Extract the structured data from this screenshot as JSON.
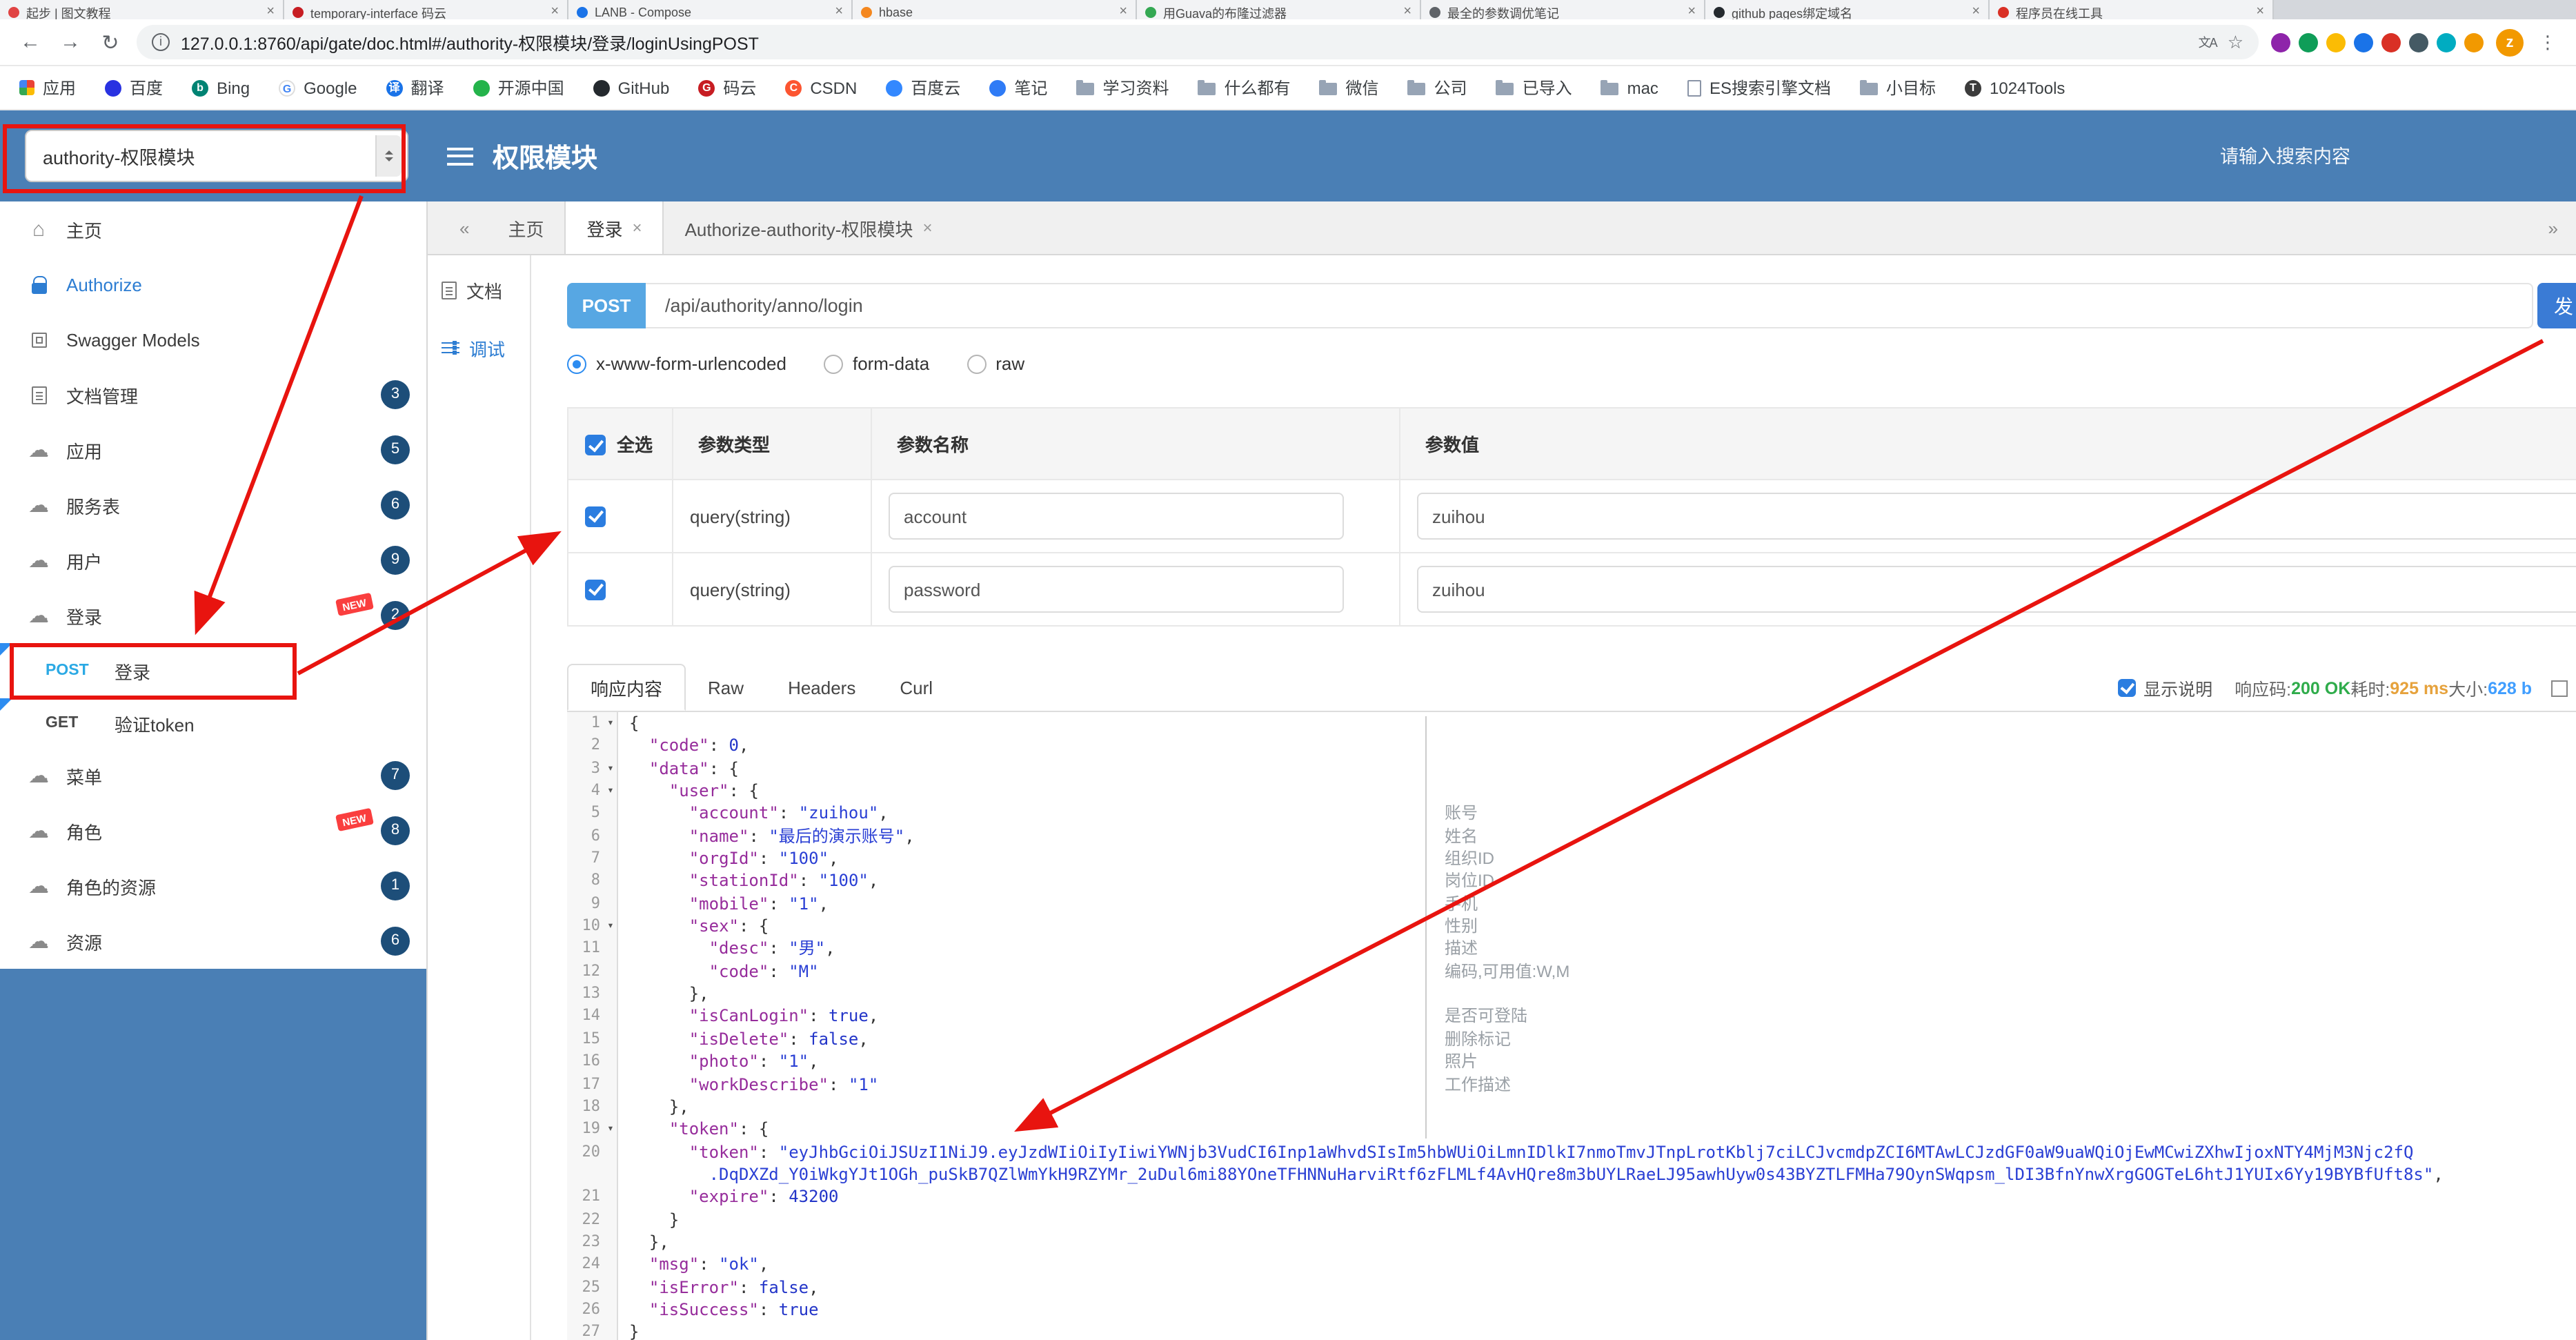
{
  "colors": {
    "header": "#4a7fb5",
    "badge": "#1d4e79",
    "post": "#57a7e3",
    "accent": "#2d7dd2",
    "red": "#e8140f",
    "key": "#962c9b",
    "str": "#2a3fd4",
    "lit": "#2335c8",
    "status_ok": "#2fac4b",
    "status_time": "#e6a23c",
    "status_size": "#409eff"
  },
  "browser": {
    "tabs": [
      {
        "title": "起步 | 图文教程",
        "color": "#e04343"
      },
      {
        "title": "temporary-interface 码云",
        "color": "#c71d23"
      },
      {
        "title": "LANB - Compose",
        "color": "#1a73e8"
      },
      {
        "title": "hbase",
        "color": "#f4871f"
      },
      {
        "title": "用Guava的布隆过滤器",
        "color": "#34a853"
      },
      {
        "title": "最全的参数调优笔记",
        "color": "#5f6368"
      },
      {
        "title": "github pages绑定域名",
        "color": "#24292e"
      },
      {
        "title": "程序员在线工具",
        "color": "#d93025"
      }
    ],
    "address": {
      "url": "127.0.0.1:8760/api/gate/doc.html#/authority-权限模块/登录/loginUsingPOST"
    },
    "extensions": [
      {
        "name": "extension-icon",
        "color": "#8e24aa"
      },
      {
        "name": "extension-icon",
        "color": "#0f9d58"
      },
      {
        "name": "extension-icon",
        "color": "#fbbc04"
      },
      {
        "name": "extension-icon",
        "color": "#1a73e8"
      },
      {
        "name": "extension-icon",
        "color": "#d93025"
      },
      {
        "name": "extension-icon",
        "color": "#455a64"
      },
      {
        "name": "extension-icon",
        "color": "#00acc1"
      },
      {
        "name": "extension-icon",
        "color": "#f29900"
      }
    ],
    "avatar": {
      "letter": "z",
      "color": "#f29900"
    },
    "bookmarks": [
      {
        "key": "apps",
        "label": "应用",
        "kind": "grid"
      },
      {
        "key": "baidu",
        "label": "百度",
        "kind": "site",
        "color": "#2932e1"
      },
      {
        "key": "bing",
        "label": "Bing",
        "kind": "site",
        "color": "#008373",
        "letter": "b"
      },
      {
        "key": "google",
        "label": "Google",
        "kind": "site",
        "color": "#ffffff",
        "letter": "G",
        "border": true
      },
      {
        "key": "translate",
        "label": "翻译",
        "kind": "site",
        "color": "#1a73e8",
        "letter": "译"
      },
      {
        "key": "oschina",
        "label": "开源中国",
        "kind": "site",
        "color": "#24b34b"
      },
      {
        "key": "github",
        "label": "GitHub",
        "kind": "site",
        "color": "#24292e"
      },
      {
        "key": "gitee",
        "label": "码云",
        "kind": "site",
        "color": "#c71d23",
        "letter": "G"
      },
      {
        "key": "csdn",
        "label": "CSDN",
        "kind": "site",
        "color": "#fc5531",
        "letter": "C"
      },
      {
        "key": "baiduyun",
        "label": "百度云",
        "kind": "site",
        "color": "#3388ff"
      },
      {
        "key": "note",
        "label": "笔记",
        "kind": "site",
        "color": "#2f7bf6"
      },
      {
        "key": "study",
        "label": "学习资料",
        "kind": "folder"
      },
      {
        "key": "everything",
        "label": "什么都有",
        "kind": "folder"
      },
      {
        "key": "wechat",
        "label": "微信",
        "kind": "folder"
      },
      {
        "key": "company",
        "label": "公司",
        "kind": "folder"
      },
      {
        "key": "imported",
        "label": "已导入",
        "kind": "folder"
      },
      {
        "key": "mac",
        "label": "mac",
        "kind": "folder"
      },
      {
        "key": "es",
        "label": "ES搜索引擎文档",
        "kind": "doc"
      },
      {
        "key": "goal",
        "label": "小目标",
        "kind": "folder"
      },
      {
        "key": "tools",
        "label": "1024Tools",
        "kind": "site",
        "color": "#3c3c3c",
        "letter": "T"
      }
    ]
  },
  "header": {
    "module_select": "authority-权限模块",
    "title": "权限模块",
    "search_placeholder": "请输入搜索内容"
  },
  "sidebar": {
    "items": [
      {
        "key": "home",
        "label": "主页",
        "icon": "home"
      },
      {
        "key": "authorize",
        "label": "Authorize",
        "icon": "lock",
        "accent": true
      },
      {
        "key": "swagger-models",
        "label": "Swagger Models",
        "icon": "models"
      },
      {
        "key": "doc-manage",
        "label": "文档管理",
        "icon": "docs",
        "badge": "3"
      },
      {
        "key": "app",
        "label": "应用",
        "icon": "cloud",
        "badge": "5"
      },
      {
        "key": "service",
        "label": "服务表",
        "icon": "cloud",
        "badge": "6"
      },
      {
        "key": "user",
        "label": "用户",
        "icon": "cloud",
        "badge": "9"
      },
      {
        "key": "login",
        "label": "登录",
        "icon": "cloud",
        "badge": "2",
        "new": true
      },
      {
        "key": "post-login",
        "label": "登录",
        "method": "POST",
        "sub": true,
        "marked": true
      },
      {
        "key": "get-token",
        "label": "验证token",
        "method": "GET",
        "sub": true,
        "marked": true
      },
      {
        "key": "menu",
        "label": "菜单",
        "icon": "cloud",
        "badge": "7"
      },
      {
        "key": "role",
        "label": "角色",
        "icon": "cloud",
        "badge": "8",
        "new": true
      },
      {
        "key": "role-resource",
        "label": "角色的资源",
        "icon": "cloud",
        "badge": "1"
      },
      {
        "key": "resource",
        "label": "资源",
        "icon": "cloud",
        "badge": "6"
      }
    ]
  },
  "tabs": {
    "collapse_left": "«",
    "collapse_right": "»",
    "items": [
      {
        "label": "主页",
        "closable": false
      },
      {
        "label": "登录",
        "closable": true,
        "active": true
      },
      {
        "label": "Authorize-authority-权限模块",
        "closable": true
      }
    ]
  },
  "doc_nav": [
    {
      "key": "doc",
      "label": "文档",
      "icon": "doc"
    },
    {
      "key": "debug",
      "label": "调试",
      "icon": "debug",
      "active": true
    }
  ],
  "request": {
    "method": "POST",
    "url": "/api/authority/anno/login",
    "send_label": "发",
    "content_types": [
      {
        "label": "x-www-form-urlencoded",
        "selected": true
      },
      {
        "label": "form-data",
        "selected": false
      },
      {
        "label": "raw",
        "selected": false
      }
    ]
  },
  "params_table": {
    "headers": [
      "全选",
      "参数类型",
      "参数名称",
      "参数值"
    ],
    "select_all_checked": true,
    "rows": [
      {
        "checked": true,
        "type": "query(string)",
        "name": "account",
        "value": "zuihou"
      },
      {
        "checked": true,
        "type": "query(string)",
        "name": "password",
        "value": "zuihou"
      }
    ]
  },
  "response": {
    "tabs": [
      {
        "label": "响应内容",
        "active": true
      },
      {
        "label": "Raw",
        "active": false
      },
      {
        "label": "Headers",
        "active": false
      },
      {
        "label": "Curl",
        "active": false
      }
    ],
    "show_desc_label": "显示说明",
    "show_desc_checked": true,
    "meta": [
      {
        "label": "响应码:",
        "value": "200 OK",
        "color": "#2fac4b"
      },
      {
        "label": "耗时:",
        "value": "925 ms",
        "color": "#e6a23c"
      },
      {
        "label": "大小:",
        "value": "628 b",
        "color": "#409eff"
      }
    ]
  },
  "code": {
    "lines": [
      {
        "n": "1",
        "fold": true,
        "s": [
          [
            "{",
            "p"
          ]
        ]
      },
      {
        "n": "2",
        "s": [
          [
            "  ",
            "p"
          ],
          [
            "\"code\"",
            "k"
          ],
          [
            ": ",
            "p"
          ],
          [
            "0",
            "l"
          ],
          [
            ",",
            "p"
          ]
        ]
      },
      {
        "n": "3",
        "fold": true,
        "s": [
          [
            "  ",
            "p"
          ],
          [
            "\"data\"",
            "k"
          ],
          [
            ": ",
            "p"
          ],
          [
            "{",
            "p"
          ]
        ]
      },
      {
        "n": "4",
        "fold": true,
        "s": [
          [
            "    ",
            "p"
          ],
          [
            "\"user\"",
            "k"
          ],
          [
            ": ",
            "p"
          ],
          [
            "{",
            "p"
          ]
        ]
      },
      {
        "n": "5",
        "ann": "账号",
        "s": [
          [
            "      ",
            "p"
          ],
          [
            "\"account\"",
            "k"
          ],
          [
            ": ",
            "p"
          ],
          [
            "\"zuihou\"",
            "s"
          ],
          [
            ",",
            "p"
          ]
        ]
      },
      {
        "n": "6",
        "ann": "姓名",
        "s": [
          [
            "      ",
            "p"
          ],
          [
            "\"name\"",
            "k"
          ],
          [
            ": ",
            "p"
          ],
          [
            "\"最后的演示账号\"",
            "s"
          ],
          [
            ",",
            "p"
          ]
        ]
      },
      {
        "n": "7",
        "ann": "组织ID",
        "s": [
          [
            "      ",
            "p"
          ],
          [
            "\"orgId\"",
            "k"
          ],
          [
            ": ",
            "p"
          ],
          [
            "\"100\"",
            "s"
          ],
          [
            ",",
            "p"
          ]
        ]
      },
      {
        "n": "8",
        "ann": "岗位ID",
        "s": [
          [
            "      ",
            "p"
          ],
          [
            "\"stationId\"",
            "k"
          ],
          [
            ": ",
            "p"
          ],
          [
            "\"100\"",
            "s"
          ],
          [
            ",",
            "p"
          ]
        ]
      },
      {
        "n": "9",
        "ann": "手机",
        "s": [
          [
            "      ",
            "p"
          ],
          [
            "\"mobile\"",
            "k"
          ],
          [
            ": ",
            "p"
          ],
          [
            "\"1\"",
            "s"
          ],
          [
            ",",
            "p"
          ]
        ]
      },
      {
        "n": "10",
        "fold": true,
        "ann": "性别",
        "s": [
          [
            "      ",
            "p"
          ],
          [
            "\"sex\"",
            "k"
          ],
          [
            ": ",
            "p"
          ],
          [
            "{",
            "p"
          ]
        ]
      },
      {
        "n": "11",
        "ann": "描述",
        "s": [
          [
            "        ",
            "p"
          ],
          [
            "\"desc\"",
            "k"
          ],
          [
            ": ",
            "p"
          ],
          [
            "\"男\"",
            "s"
          ],
          [
            ",",
            "p"
          ]
        ]
      },
      {
        "n": "12",
        "ann": "编码,可用值:W,M",
        "s": [
          [
            "        ",
            "p"
          ],
          [
            "\"code\"",
            "k"
          ],
          [
            ": ",
            "p"
          ],
          [
            "\"M\"",
            "s"
          ]
        ]
      },
      {
        "n": "13",
        "s": [
          [
            "      ",
            "p"
          ],
          [
            "},",
            "p"
          ]
        ]
      },
      {
        "n": "14",
        "ann": "是否可登陆",
        "s": [
          [
            "      ",
            "p"
          ],
          [
            "\"isCanLogin\"",
            "k"
          ],
          [
            ": ",
            "p"
          ],
          [
            "true",
            "l"
          ],
          [
            ",",
            "p"
          ]
        ]
      },
      {
        "n": "15",
        "ann": "删除标记",
        "s": [
          [
            "      ",
            "p"
          ],
          [
            "\"isDelete\"",
            "k"
          ],
          [
            ": ",
            "p"
          ],
          [
            "false",
            "l"
          ],
          [
            ",",
            "p"
          ]
        ]
      },
      {
        "n": "16",
        "ann": "照片",
        "s": [
          [
            "      ",
            "p"
          ],
          [
            "\"photo\"",
            "k"
          ],
          [
            ": ",
            "p"
          ],
          [
            "\"1\"",
            "s"
          ],
          [
            ",",
            "p"
          ]
        ]
      },
      {
        "n": "17",
        "ann": "工作描述",
        "s": [
          [
            "      ",
            "p"
          ],
          [
            "\"workDescribe\"",
            "k"
          ],
          [
            ": ",
            "p"
          ],
          [
            "\"1\"",
            "s"
          ]
        ]
      },
      {
        "n": "18",
        "s": [
          [
            "    ",
            "p"
          ],
          [
            "},",
            "p"
          ]
        ]
      },
      {
        "n": "19",
        "fold": true,
        "s": [
          [
            "    ",
            "p"
          ],
          [
            "\"token\"",
            "k"
          ],
          [
            ": ",
            "p"
          ],
          [
            "{",
            "p"
          ]
        ]
      },
      {
        "n": "20",
        "s": [
          [
            "      ",
            "p"
          ],
          [
            "\"token\"",
            "k"
          ],
          [
            ": ",
            "p"
          ],
          [
            "\"eyJhbGciOiJSUzI1NiJ9.eyJzdWIiOiIyIiwiYWNjb3VudCI6Inp1aWhvdSIsIm5hbWUiOiLmnIDlkI7nmoTmvJTnpLrotKblj7ciLCJvcmdpZCI6MTAwLCJzdGF0aW9uaWQiOjEwMCwiZXhwIjoxNTY4MjM3Njc2fQ",
            "s"
          ]
        ]
      },
      {
        "n": "",
        "s": [
          [
            "        ",
            "p"
          ],
          [
            ".DqDXZd_Y0iWkgYJt1OGh_puSkB7QZlWmYkH9RZYMr_2uDul6mi88YOneTFHNNuHarviRtf6zFLMLf4AvHQre8m3bUYLRaeLJ95awhUyw0s43BYZTLFMHa79OynSWqpsm_lDI3BfnYnwXrgGOGTeL6htJ1YUIx6Yy19BYBfUft8s\"",
            "s"
          ],
          [
            ",",
            "p"
          ]
        ]
      },
      {
        "n": "21",
        "s": [
          [
            "      ",
            "p"
          ],
          [
            "\"expire\"",
            "k"
          ],
          [
            ": ",
            "p"
          ],
          [
            "43200",
            "l"
          ]
        ]
      },
      {
        "n": "22",
        "s": [
          [
            "    ",
            "p"
          ],
          [
            "}",
            "p"
          ]
        ]
      },
      {
        "n": "23",
        "s": [
          [
            "  ",
            "p"
          ],
          [
            "},",
            "p"
          ]
        ]
      },
      {
        "n": "24",
        "s": [
          [
            "  ",
            "p"
          ],
          [
            "\"msg\"",
            "k"
          ],
          [
            ": ",
            "p"
          ],
          [
            "\"ok\"",
            "s"
          ],
          [
            ",",
            "p"
          ]
        ]
      },
      {
        "n": "25",
        "s": [
          [
            "  ",
            "p"
          ],
          [
            "\"isError\"",
            "k"
          ],
          [
            ": ",
            "p"
          ],
          [
            "false",
            "l"
          ],
          [
            ",",
            "p"
          ]
        ]
      },
      {
        "n": "26",
        "s": [
          [
            "  ",
            "p"
          ],
          [
            "\"isSuccess\"",
            "k"
          ],
          [
            ": ",
            "p"
          ],
          [
            "true",
            "l"
          ]
        ]
      },
      {
        "n": "27",
        "s": [
          [
            "}",
            "p"
          ]
        ]
      }
    ]
  }
}
